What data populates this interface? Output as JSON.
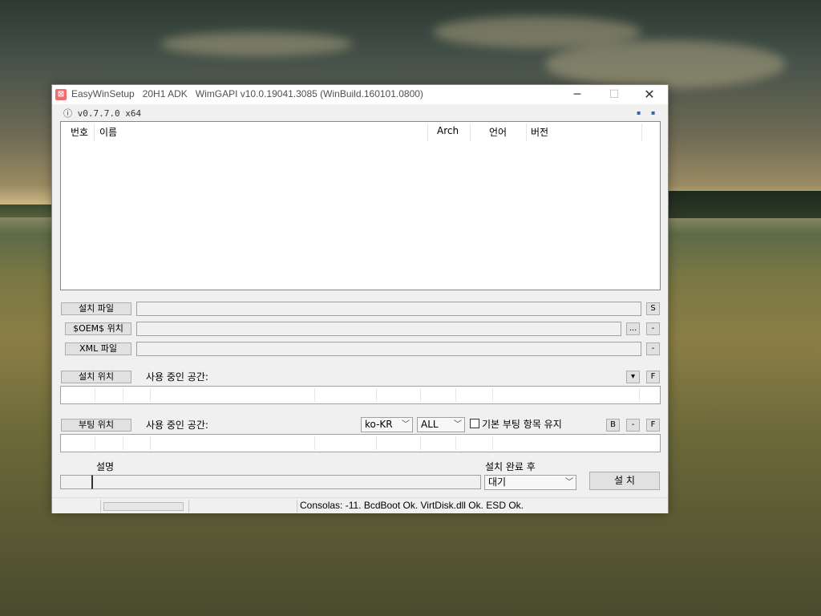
{
  "window": {
    "icon_glyph": "⊠",
    "title": "EasyWinSetup   20H1 ADK   WimGAPI v10.0.19041.3085 (WinBuild.160101.0800)",
    "minimize": "─",
    "maximize": "☐",
    "close": "✕"
  },
  "version": "ⓘ v0.7.7.0 x64",
  "corner_dots": [
    "▪",
    "▪"
  ],
  "list": {
    "columns": [
      "번호",
      "이름",
      "Arch",
      "언어",
      "버전"
    ]
  },
  "setup_file": {
    "button": "설치 파일",
    "side_button": "S"
  },
  "oem": {
    "button": "$OEM$ 위치",
    "browse": "...",
    "remove": "-"
  },
  "xml": {
    "button": "XML 파일",
    "remove": "-"
  },
  "install_location": {
    "button": "설치 위치",
    "used_space_label": "사용 중인 공간:",
    "dropdown": "▾",
    "format": "F"
  },
  "boot_location": {
    "button": "부팅 위치",
    "used_space_label": "사용 중인 공간:",
    "locale": "ko-KR",
    "scope": "ALL",
    "keep_boot_entry_label": "기본 부팅 항목 유지",
    "b_button": "B",
    "remove": "-",
    "format": "F"
  },
  "description_label": "설명",
  "after_install_label": "설치 완료 후",
  "after_install_value": "대기",
  "install_button": "설 치",
  "status": "Consolas: -11. BcdBoot Ok. VirtDisk.dll Ok. ESD Ok."
}
